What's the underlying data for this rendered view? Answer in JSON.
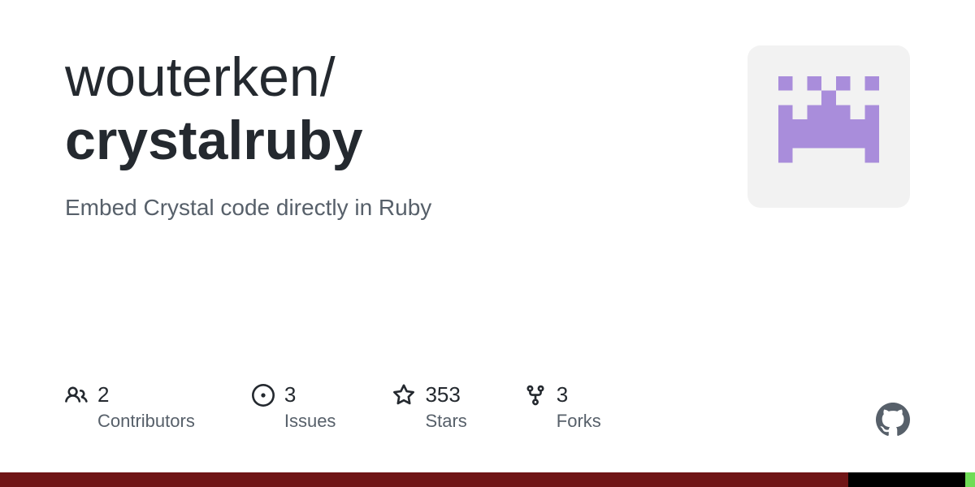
{
  "repo": {
    "owner": "wouterken",
    "separator": "/",
    "name": "crystalruby",
    "description": "Embed Crystal code directly in Ruby"
  },
  "stats": {
    "contributors": {
      "value": "2",
      "label": "Contributors"
    },
    "issues": {
      "value": "3",
      "label": "Issues"
    },
    "stars": {
      "value": "353",
      "label": "Stars"
    },
    "forks": {
      "value": "3",
      "label": "Forks"
    }
  },
  "languages": [
    {
      "color": "#701516",
      "percent": 87
    },
    {
      "color": "#000000",
      "percent": 12
    },
    {
      "color": "#6fdc56",
      "percent": 1
    }
  ],
  "avatar": {
    "color": "#a98ddb"
  }
}
